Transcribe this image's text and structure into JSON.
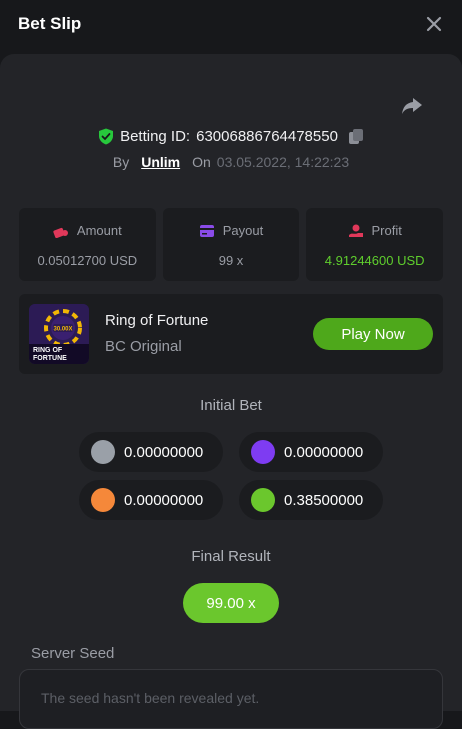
{
  "header": {
    "title": "Bet Slip"
  },
  "bet": {
    "betting_id_label": "Betting ID:",
    "betting_id": "63006886764478550",
    "by_label": "By",
    "user": "Unlim",
    "on_label": "On",
    "date": "03.05.2022, 14:22:23"
  },
  "stats": {
    "amount": {
      "label": "Amount",
      "value": "0.05012700 USD"
    },
    "payout": {
      "label": "Payout",
      "value": "99 x"
    },
    "profit": {
      "label": "Profit",
      "value": "4.91244600 USD"
    }
  },
  "game": {
    "name": "Ring of Fortune",
    "provider": "BC Original",
    "play_label": "Play Now",
    "thumb_text": "RING OF FORTUNE",
    "thumb_badge": "30.00X"
  },
  "initial_bet": {
    "title": "Initial Bet",
    "chips": [
      {
        "color": "#9aa0a8",
        "value": "0.00000000"
      },
      {
        "color": "#7e3cf2",
        "value": "0.00000000"
      },
      {
        "color": "#f5883a",
        "value": "0.00000000"
      },
      {
        "color": "#6bc72d",
        "value": "0.38500000"
      }
    ]
  },
  "final_result": {
    "title": "Final Result",
    "value": "99.00 x"
  },
  "server_seed": {
    "label": "Server Seed",
    "placeholder": "The seed hasn't been revealed yet."
  },
  "colors": {
    "accent_green": "#5fce2d",
    "button_green": "#4ea81b",
    "panel": "#232428",
    "card": "#1b1c1f"
  }
}
